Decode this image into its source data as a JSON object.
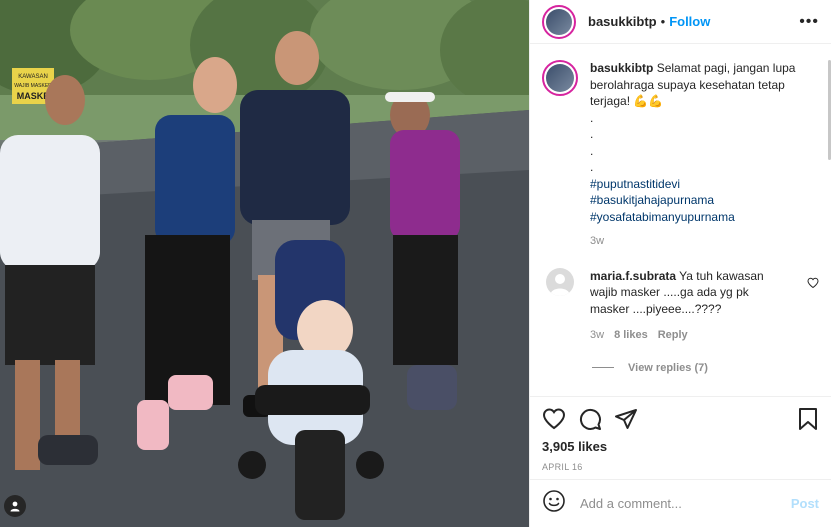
{
  "post": {
    "username": "basukkibtp",
    "follow_label": "Follow",
    "separator": "•",
    "more_label": "•••"
  },
  "caption": {
    "username": "basukkibtp",
    "text": "Selamat pagi, jangan lupa berolahraga supaya kesehatan tetap terjaga! 💪💪",
    "dots": [
      ".",
      ".",
      ".",
      "."
    ],
    "hashtags": [
      "#puputnastitidevi",
      "#basukitjahajapurnama",
      "#yosafatabimanyupurnama"
    ],
    "age": "3w"
  },
  "comments": [
    {
      "username": "maria.f.subrata",
      "text": "Ya tuh kawasan wajib masker .....ga ada yg pk masker ....piyeee....????",
      "age": "3w",
      "likes": "8 likes",
      "reply_label": "Reply",
      "view_replies": "View replies (7)"
    }
  ],
  "stats": {
    "likes": "3,905 likes",
    "date": "APRIL 16"
  },
  "composer": {
    "placeholder": "Add a comment...",
    "post_label": "Post"
  },
  "photo": {
    "sign_line1": "KAWASAN",
    "sign_line2": "WAJIB MASKER",
    "sign_line3": "MASKE"
  },
  "icons": {
    "user_tag": "user-tag-icon",
    "heart": "heart-icon",
    "comment": "comment-icon",
    "share": "share-icon",
    "save": "bookmark-icon",
    "emoji": "emoji-icon",
    "more": "more-icon"
  },
  "colors": {
    "link": "#0095f6",
    "hashtag": "#00376b",
    "muted": "#8e8e8e",
    "post_disabled": "#b2dffc"
  }
}
